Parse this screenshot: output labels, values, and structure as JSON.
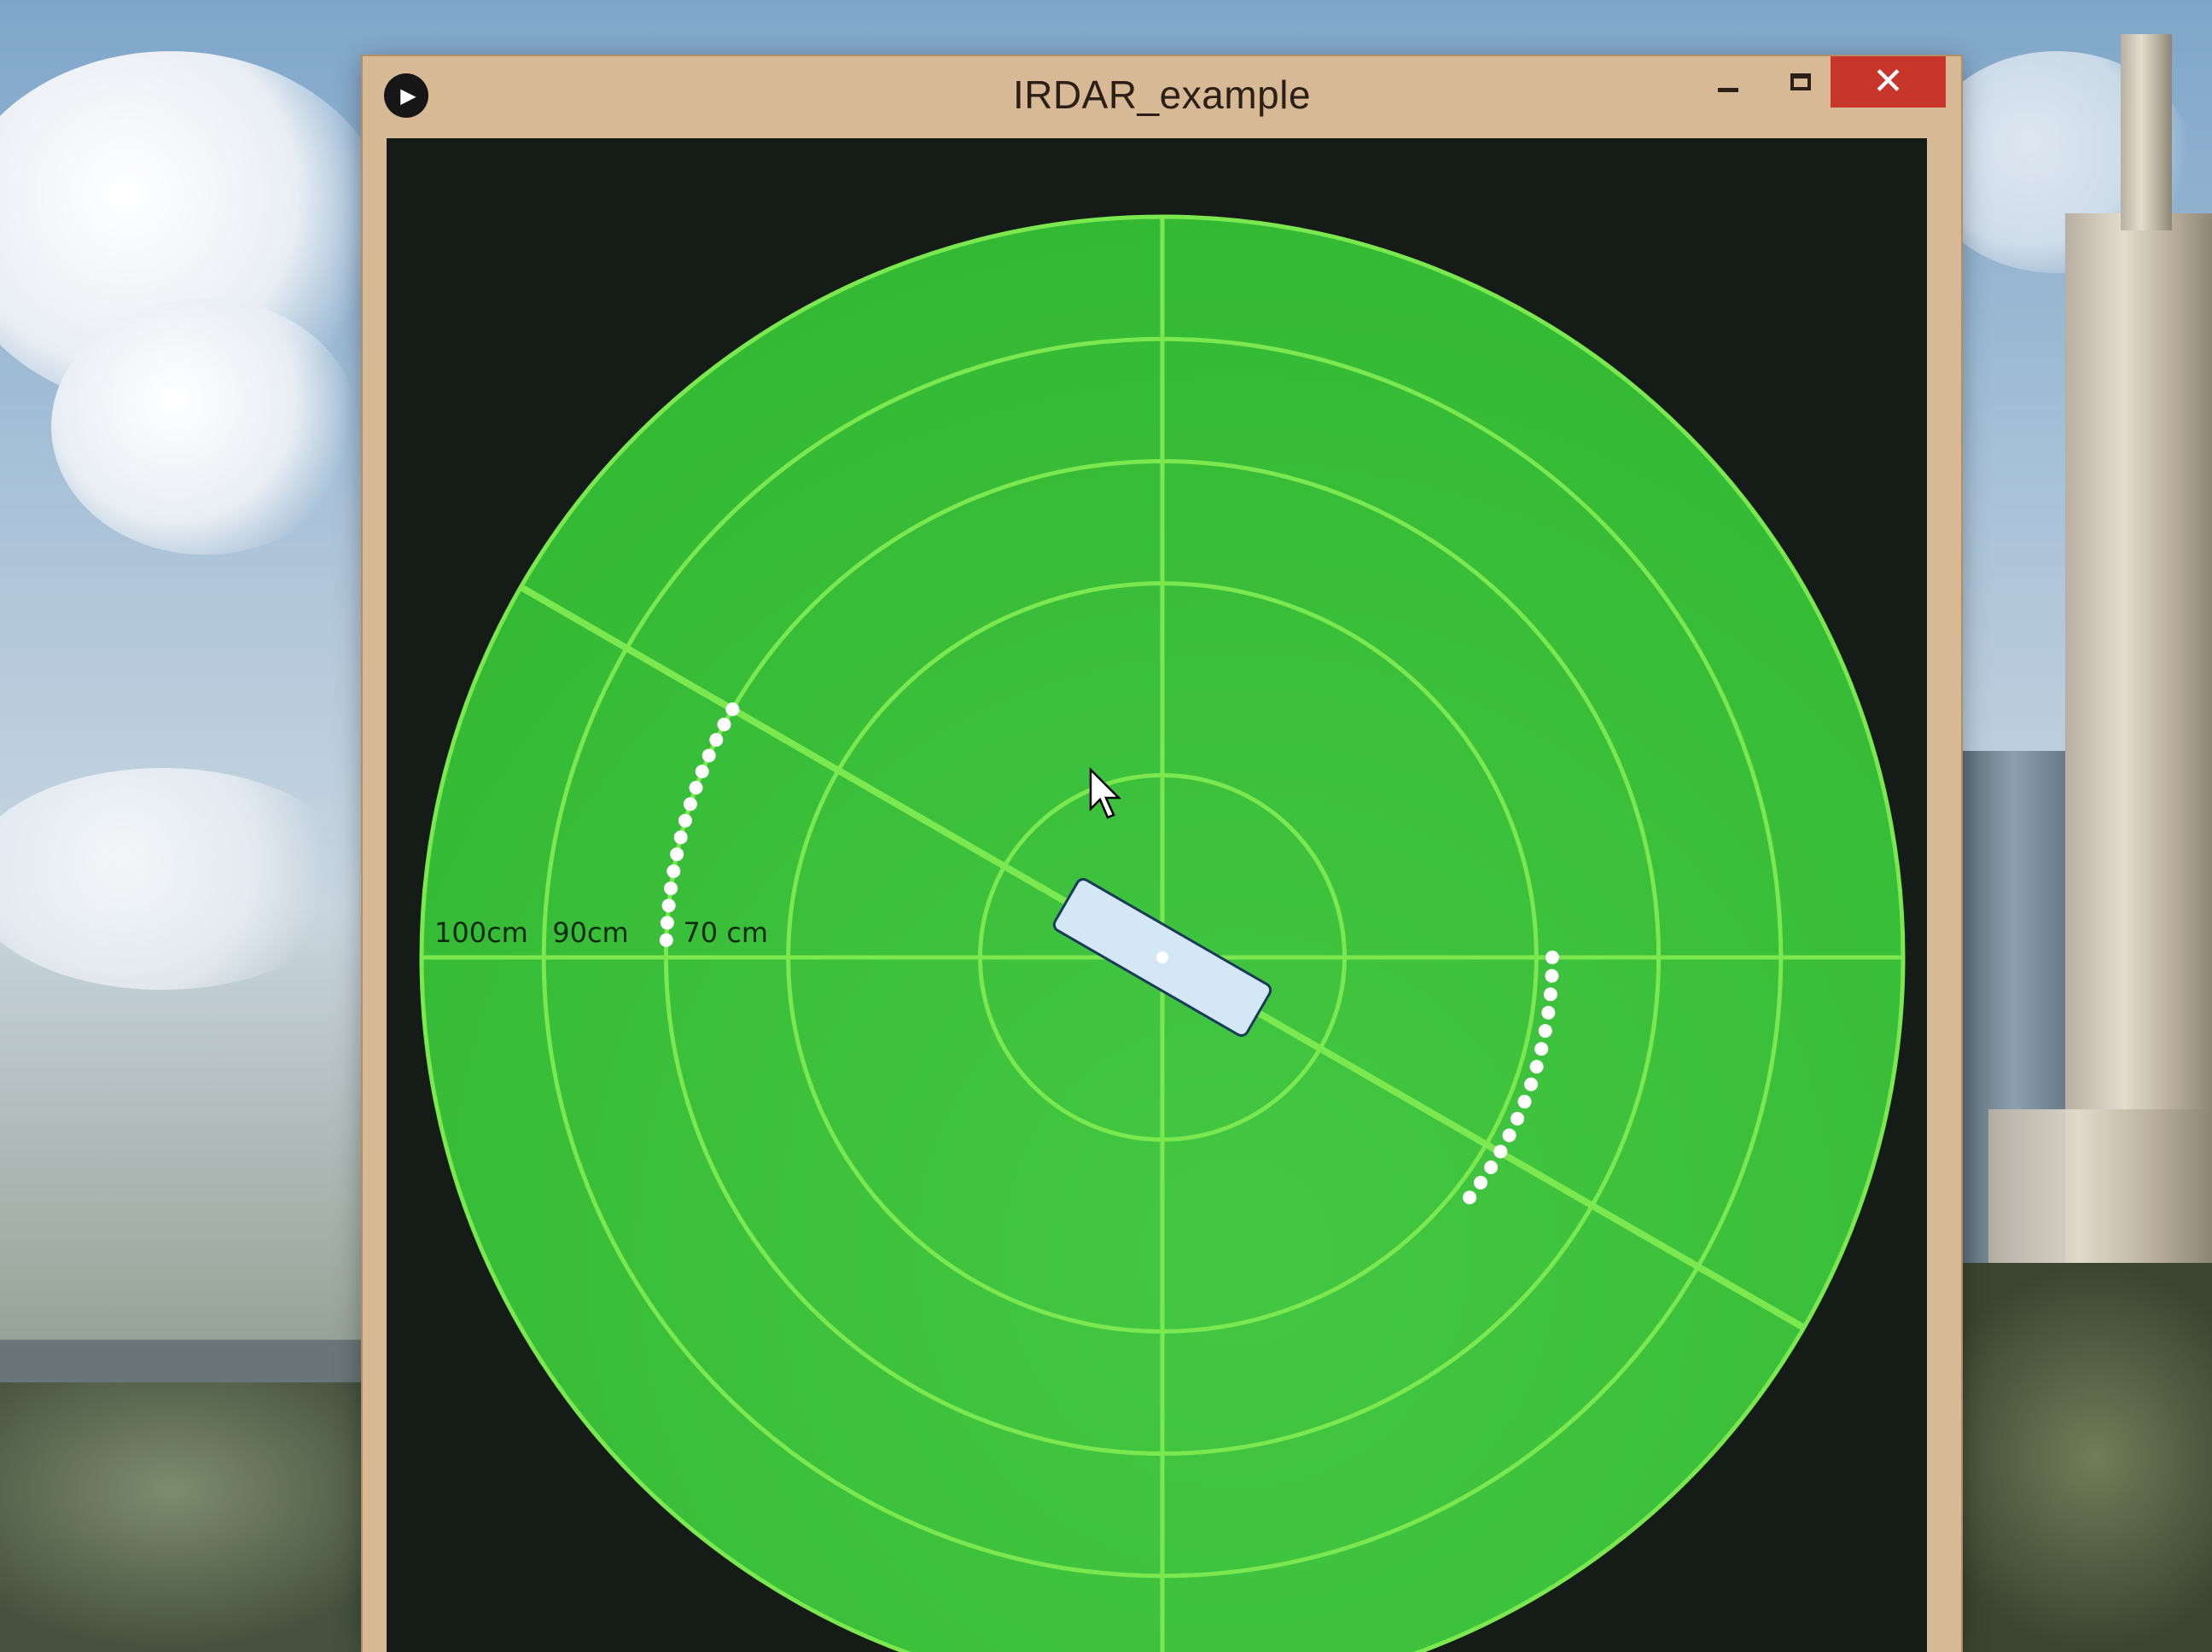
{
  "window": {
    "title": "IRDAR_example",
    "icon": "play-icon",
    "minimize_icon": "minimize-icon",
    "maximize_icon": "maximize-icon",
    "close_icon": "close-icon",
    "close_color": "#c7352b"
  },
  "radar": {
    "colors": {
      "background": "#151b16",
      "disc": "#33b833",
      "grid_line": "#7be84f",
      "echo": "#ffffff",
      "sensor": "#d3e8f4"
    },
    "range_labels": [
      {
        "text": "100cm",
        "radius_cm": 100
      },
      {
        "text": "90cm",
        "radius_cm": 90
      },
      {
        "text": "70 cm",
        "radius_cm": 70
      }
    ],
    "sweep_angle_deg": 150,
    "sensor_label": "sensor-block",
    "echo_arcs": [
      {
        "side": "left",
        "distance_cm": 70,
        "angle_from_deg": 150,
        "angle_to_deg": 178
      },
      {
        "side": "right",
        "distance_cm": 55,
        "angle_from_deg": -38,
        "angle_to_deg": 0
      }
    ]
  }
}
